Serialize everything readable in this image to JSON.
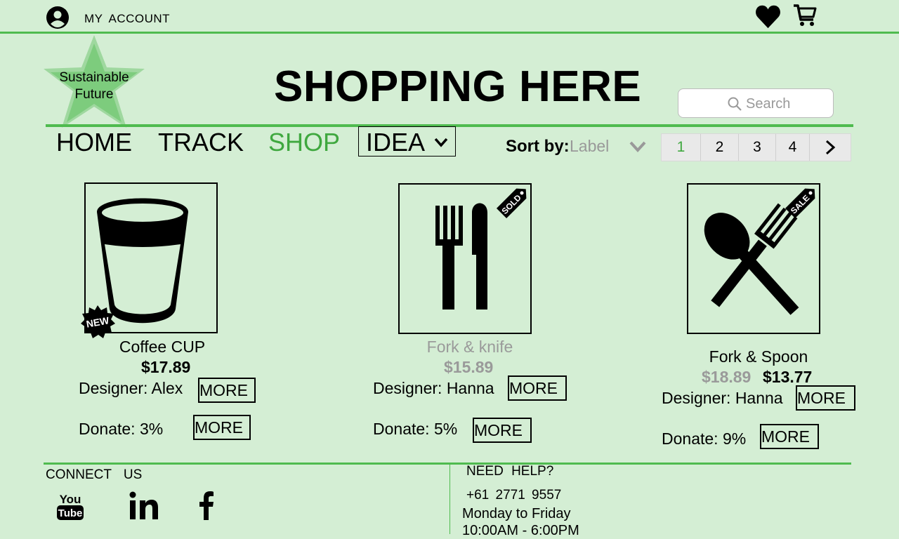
{
  "topbar": {
    "account_label": "MY  ACCOUNT"
  },
  "header": {
    "badge_text_line1": "Sustainable",
    "badge_text_line2": "Future",
    "title": "SHOPPING HERE",
    "search_placeholder": "Search"
  },
  "nav": {
    "items": [
      {
        "label": "HOME"
      },
      {
        "label": "TRACK"
      },
      {
        "label": "SHOP",
        "active": true
      },
      {
        "label": "IDEA"
      }
    ],
    "sort_label": "Sort by:",
    "sort_value": "Label",
    "pages": [
      "1",
      "2",
      "3",
      "4"
    ],
    "current_page": "1"
  },
  "products": [
    {
      "name": "Coffee CUP",
      "price": "$17.89",
      "designer": "Designer: Alex",
      "donate": "Donate: 3%",
      "badge": "NEW",
      "more_label": "MORE",
      "icon": "cup-icon"
    },
    {
      "name": "Fork & knife",
      "price": "$15.89",
      "designer": "Designer: Hanna",
      "donate": "Donate: 5%",
      "badge": "SOLD",
      "more_label": "MORE",
      "icon": "fork-knife-icon",
      "sold_out": true
    },
    {
      "name": "Fork & Spoon",
      "old_price": "$18.89",
      "price": "$13.77",
      "designer": "Designer: Hanna",
      "donate": "Donate: 9%",
      "badge": "SALE",
      "more_label": "MORE",
      "icon": "fork-spoon-icon"
    }
  ],
  "footer": {
    "connect_title": "CONNECT   US",
    "social": [
      "youtube-icon",
      "linkedin-icon",
      "facebook-icon"
    ],
    "help_title": "NEED  HELP?",
    "phone": "+61 2771  9557",
    "days": "Monday to  Friday",
    "hours": "10:00AM - 6:00PM"
  },
  "colors": {
    "background": "#d4eed4",
    "accent": "#4fbb4f",
    "active_nav": "#3fa83f",
    "muted": "#9a9a9a"
  }
}
